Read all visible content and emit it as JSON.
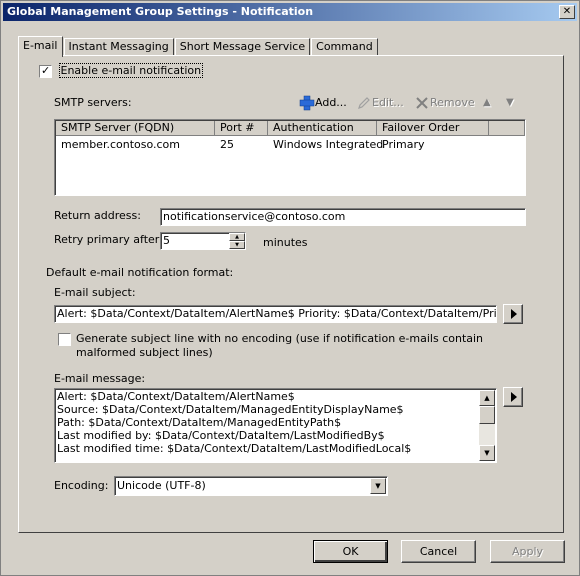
{
  "window": {
    "title": "Global Management Group Settings - Notification",
    "close_glyph": "✕"
  },
  "tabs": [
    "E-mail",
    "Instant Messaging",
    "Short Message Service",
    "Command"
  ],
  "enable_notification": {
    "label": "Enable e-mail notification",
    "checked": true
  },
  "smtp": {
    "label": "SMTP servers:",
    "toolbar": {
      "add": "Add...",
      "edit": "Edit...",
      "remove": "Remove"
    },
    "columns": [
      "SMTP Server (FQDN)",
      "Port #",
      "Authentication",
      "Failover Order"
    ],
    "rows": [
      {
        "server": "member.contoso.com",
        "port": "25",
        "auth": "Windows Integrated",
        "order": "Primary"
      }
    ]
  },
  "return_address": {
    "label": "Return address:",
    "value": "notificationservice@contoso.com"
  },
  "retry": {
    "label": "Retry primary after:",
    "value": "5",
    "unit": "minutes"
  },
  "format_label": "Default e-mail notification format:",
  "subject": {
    "label": "E-mail subject:",
    "value": "Alert: $Data/Context/DataItem/AlertName$ Priority: $Data/Context/DataItem/Priority$ Sever"
  },
  "no_encoding": {
    "label_line1": "Generate subject line with no encoding (use if notification e-mails contain",
    "label_line2": "malformed subject lines)",
    "checked": false
  },
  "message": {
    "label": "E-mail message:",
    "lines": [
      "Alert: $Data/Context/DataItem/AlertName$",
      "Source: $Data/Context/DataItem/ManagedEntityDisplayName$",
      "Path: $Data/Context/DataItem/ManagedEntityPath$",
      "Last modified by: $Data/Context/DataItem/LastModifiedBy$",
      "Last modified time: $Data/Context/DataItem/LastModifiedLocal$"
    ]
  },
  "encoding": {
    "label": "Encoding:",
    "value": "Unicode (UTF-8)"
  },
  "buttons": {
    "ok": "OK",
    "cancel": "Cancel",
    "apply": "Apply"
  },
  "colors": {
    "title_start": "#0a246a",
    "title_end": "#a6caf0",
    "face": "#d4d0c8",
    "add_icon": "#2a6ad8",
    "remove_icon": "#808080"
  }
}
